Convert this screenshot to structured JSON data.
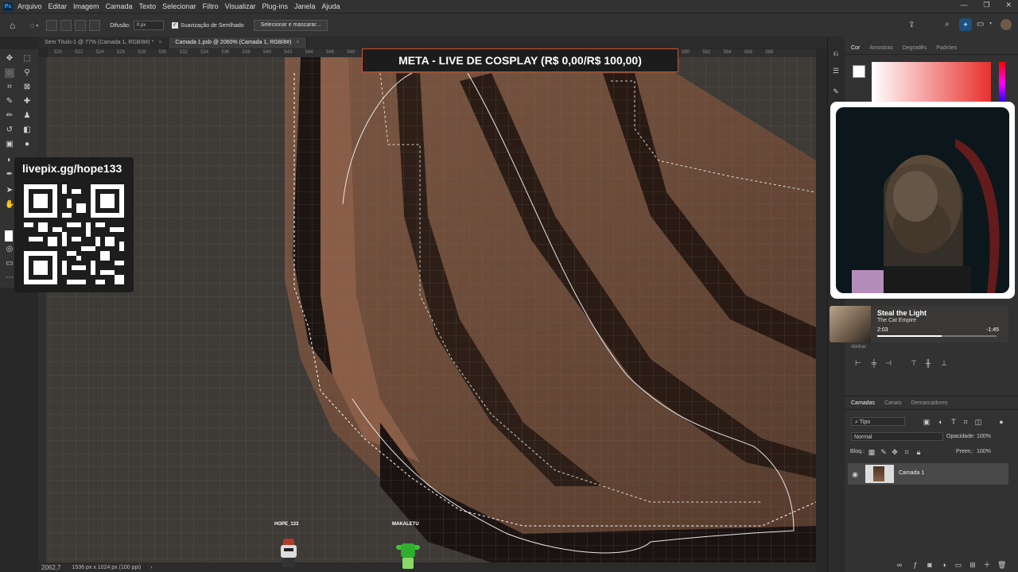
{
  "menu": {
    "app_icon": "Ps",
    "items": [
      "Arquivo",
      "Editar",
      "Imagem",
      "Camada",
      "Texto",
      "Selecionar",
      "Filtro",
      "Visualizar",
      "Plug-ins",
      "Janela",
      "Ajuda"
    ]
  },
  "options": {
    "feather_label": "Difusão:",
    "feather_value": "0 px",
    "antialias_label": "Suavização de Serrilhado",
    "select_mask_button": "Selecionar e mascarar..."
  },
  "tabs": [
    {
      "label": "Sem Título-1 @ 77% (Camada 1, RGB/8#) *"
    },
    {
      "label": "Camada 1.psb @ 2060% (Camada 1, RGB/8#)"
    }
  ],
  "ruler_ticks": [
    "520",
    "522",
    "524",
    "526",
    "528",
    "530",
    "532",
    "534",
    "536",
    "538",
    "540",
    "542",
    "544",
    "546",
    "548",
    "550",
    "552",
    "554",
    "556",
    "558",
    "560",
    "562",
    "564",
    "566",
    "568",
    "570",
    "572",
    "574",
    "576",
    "578",
    "580",
    "582",
    "584",
    "586",
    "588"
  ],
  "goal_banner": "META - LIVE DE COSPLAY (R$ 0,00/R$ 100,00)",
  "donation": {
    "url": "livepix.gg/hope133"
  },
  "status": {
    "zoom": "2062,7",
    "dims": "1536 px x 1024 px (100 ppi)"
  },
  "avatars": [
    {
      "name": "HOPE_133",
      "color": "#c8c8c8"
    },
    {
      "name": "MAKALETU",
      "color": "#3fc23f"
    }
  ],
  "color_panel": {
    "tabs": [
      "Cor",
      "Amostras",
      "Degradês",
      "Padrões"
    ],
    "active": "Cor"
  },
  "music": {
    "title": "Steal the Light",
    "artist": "The Cat Empire",
    "elapsed": "2:03",
    "remaining": "-1:45",
    "progress": 0.54
  },
  "align": {
    "label": "Alinhar:"
  },
  "layers_panel": {
    "tabs": [
      "Camadas",
      "Canais",
      "Demarcadores"
    ],
    "active": "Camadas",
    "filter_label": "Tipo",
    "blend_mode": "Normal",
    "opacity_label": "Opacidade:",
    "opacity_value": "100%",
    "lock_label": "Bloq.:",
    "fill_label": "Preen.:",
    "fill_value": "100%",
    "layers": [
      {
        "name": "Camada 1",
        "visible": true
      }
    ]
  },
  "colors": {
    "accent": "#d2502a",
    "ps_blue": "#31a8ff"
  }
}
